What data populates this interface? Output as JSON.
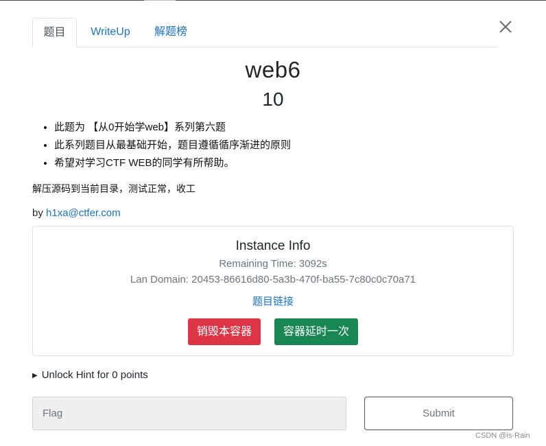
{
  "tabs": [
    {
      "label": "题目",
      "active": true
    },
    {
      "label": "WriteUp",
      "active": false
    },
    {
      "label": "解题榜",
      "active": false
    }
  ],
  "challenge": {
    "name": "web6",
    "points": "10",
    "description": [
      "此题为 【从0开始学web】系列第六题",
      "此系列题目从最基础开始，题目遵循循序渐进的原则",
      "希望对学习CTF WEB的同学有所帮助。"
    ],
    "note": "解压源码到当前目录，测试正常，收工",
    "author_prefix": "by ",
    "author": "h1xa@ctfer.com"
  },
  "instance": {
    "title": "Instance Info",
    "remaining_time": "Remaining Time: 3092s",
    "lan_domain": "Lan Domain: 20453-86616d80-5a3b-470f-ba55-7c80c0c70a71",
    "link": "题目链接",
    "destroy_label": "销毁本容器",
    "extend_label": "容器延时一次"
  },
  "hint": {
    "label": "Unlock Hint for 0 points"
  },
  "form": {
    "flag_placeholder": "Flag",
    "submit_label": "Submit"
  },
  "watermark": "CSDN @is-Rain",
  "colors": {
    "link": "#1a73c7",
    "danger": "#dc3545",
    "success": "#198754"
  },
  "icons": {
    "close": "close-icon",
    "hint_toggle": "triangle-right-icon"
  }
}
